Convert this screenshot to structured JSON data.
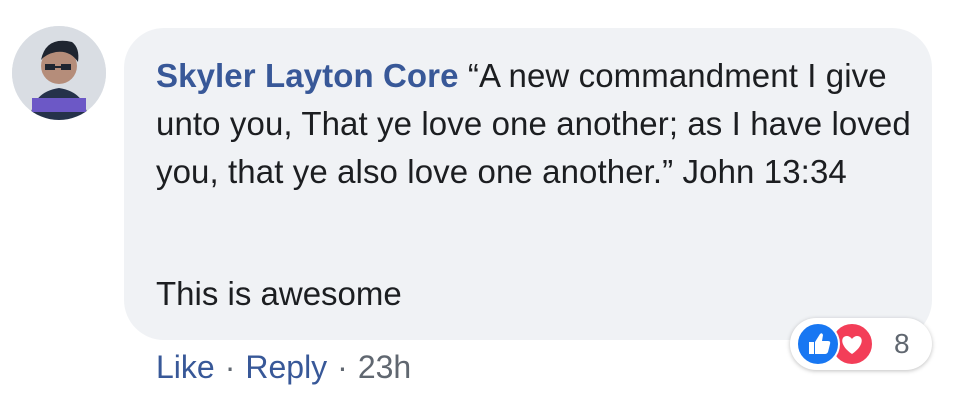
{
  "comment": {
    "author": "Skyler Layton Core",
    "text": "“A new commandment I give unto you, That ye love one another; as I have loved you, that ye also love one another.” John 13:34",
    "text2": "This is awesome"
  },
  "actions": {
    "like": "Like",
    "reply": "Reply",
    "separator": "·",
    "time": "23h"
  },
  "reactions": {
    "count": "8",
    "icons": [
      "like-icon",
      "love-icon"
    ],
    "colors": {
      "like": "#1877f2",
      "love": "#f33e58"
    }
  },
  "theme": {
    "author_color": "#385898",
    "bubble_bg": "#f0f2f5"
  }
}
